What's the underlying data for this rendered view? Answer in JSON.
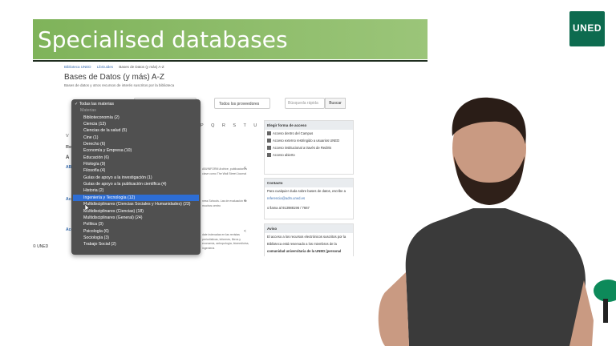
{
  "slide": {
    "title": "Specialised databases",
    "logo_text": "UNED"
  },
  "screen": {
    "breadcrumbs": [
      "Biblioteca UNED",
      "LibGuides",
      "Bases de Datos (y más) A-Z"
    ],
    "title": "Bases de Datos (y más) A-Z",
    "subtitle": "Bases de datos y otros recursos de interés suscritos por la biblioteca",
    "providers_select": "Todos los proveedores",
    "search_placeholder": "Búsqueda rápida",
    "search_button": "Buscar",
    "letters": "P Q R S T U",
    "left_fragments": {
      "v": "V",
      "re": "Re",
      "a": "A"
    },
    "entries": [
      {
        "title": "ABI",
        "desc": "ABI/INFORM Archive, publicaciones clave como The Wall Street Journal"
      },
      {
        "title": "Acc",
        "desc": "ness Schools. Las de evaluación de muchos centro"
      },
      {
        "title": "Acc",
        "desc": "dale indexadas en las revistas periodísticas, informes, libros y economía, antropología, biomedicina, ingeniería"
      }
    ],
    "panels": {
      "access": {
        "header": "Elegir forma de acceso",
        "rows": [
          "Acceso dentro del Campus",
          "Acceso externo restringido a usuarios UNED",
          "Acceso institucional a través de RedIris",
          "Acceso abierto"
        ]
      },
      "contact": {
        "header": "Contacto",
        "line1": "Para cualquier duda sobre bases de datos, escribe a",
        "email": "referencia@adm.uned.es",
        "phone": "o llama al 913988196 / 7667"
      },
      "notice": {
        "header": "Aviso",
        "line1": "El acceso a los recursos electrónicos suscritos por la",
        "line2": "Biblioteca está reservado a los miembros de la",
        "line3": "comunidad universitaria de la UNED (personal"
      }
    },
    "dropdown": {
      "selected": "Todas las materias",
      "group_label": "Materias",
      "items": [
        "Biblioteconomía (2)",
        "Ciencia (13)",
        "Ciencias de la salud (5)",
        "Cine (1)",
        "Derecho (6)",
        "Economía y Empresa (10)",
        "Educación (6)",
        "Filología (9)",
        "Filosofía (4)",
        "Guías de apoyo a la investigación (1)",
        "Guías de apoyo a la publicación científica (4)",
        "Historia (2)",
        "Ingeniería y Tecnología (12)",
        "Multidisciplinares (Ciencias Sociales y Humanidades) (23)",
        "Multidisciplinares (Ciencias) (18)",
        "Multidisciplinares (General) (24)",
        "Política (3)",
        "Psicología (6)",
        "Sociología (3)",
        "Trabajo Social (2)"
      ],
      "highlighted": "Ingeniería y Tecnología (12)"
    }
  },
  "footer": "© UNED",
  "colors": {
    "banner": "#8dbd66",
    "uned_green": "#0d6b4f",
    "highlight": "#2d6dd4"
  }
}
